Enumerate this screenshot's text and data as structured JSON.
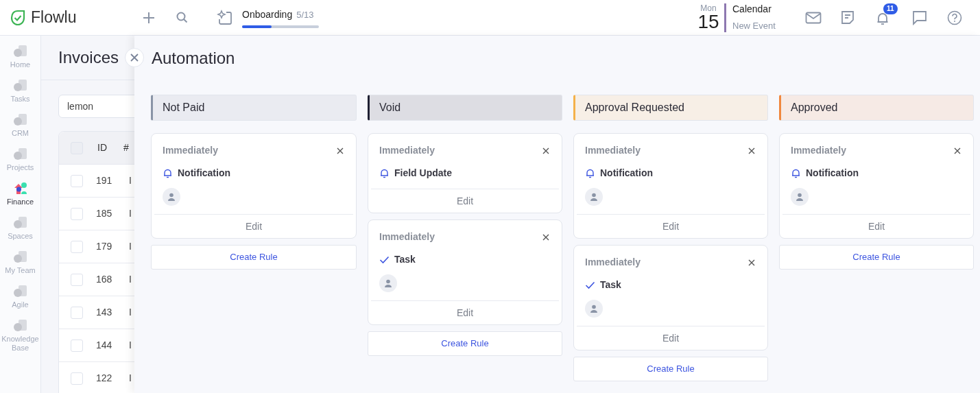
{
  "app": {
    "name": "Flowlu"
  },
  "onboarding": {
    "label": "Onboarding",
    "count": "5/13",
    "level": 0.38
  },
  "calendar": {
    "weekday": "Mon",
    "day": "15",
    "title": "Calendar",
    "subtitle": "New Event"
  },
  "notifications": {
    "badge": "11"
  },
  "sidebar": {
    "items": [
      {
        "label": "Home",
        "selected": false
      },
      {
        "label": "Tasks",
        "selected": false
      },
      {
        "label": "CRM",
        "selected": false
      },
      {
        "label": "Projects",
        "selected": false
      },
      {
        "label": "Finance",
        "selected": true
      },
      {
        "label": "Spaces",
        "selected": false
      },
      {
        "label": "My Team",
        "selected": false
      },
      {
        "label": "Agile",
        "selected": false
      },
      {
        "label": "Knowledge Base",
        "selected": false
      }
    ]
  },
  "invoices": {
    "title": "Invoices",
    "search": {
      "value": "lemon"
    },
    "columns": [
      "ID",
      "#"
    ],
    "select_all": {
      "checked": false
    },
    "rows": [
      {
        "checked": false,
        "id": "191",
        "number": "I"
      },
      {
        "checked": false,
        "id": "185",
        "number": "I"
      },
      {
        "checked": false,
        "id": "179",
        "number": "I"
      },
      {
        "checked": false,
        "id": "168",
        "number": "I"
      },
      {
        "checked": false,
        "id": "143",
        "number": "I"
      },
      {
        "checked": false,
        "id": "144",
        "number": "I"
      },
      {
        "checked": false,
        "id": "122",
        "number": "I"
      }
    ]
  },
  "automation": {
    "title": "Automation",
    "columns": [
      {
        "name": "Not Paid",
        "color": "#8a94a6",
        "rules": [
          {
            "timing": "Immediately",
            "kind": "notification",
            "action": "Notification",
            "avatar": true,
            "edit": "Edit"
          }
        ],
        "create": "Create Rule"
      },
      {
        "name": "Void",
        "color": "#1f2033",
        "rules": [
          {
            "timing": "Immediately",
            "kind": "notification",
            "action": "Field Update",
            "avatar": false,
            "edit": "Edit"
          },
          {
            "timing": "Immediately",
            "kind": "task",
            "action": "Task",
            "avatar": true,
            "edit": "Edit"
          }
        ],
        "create": "Create Rule"
      },
      {
        "name": "Approval Requested",
        "color": "#f4b14a",
        "rules": [
          {
            "timing": "Immediately",
            "kind": "notification",
            "action": "Notification",
            "avatar": true,
            "edit": "Edit"
          },
          {
            "timing": "Immediately",
            "kind": "task",
            "action": "Task",
            "avatar": true,
            "edit": "Edit"
          }
        ],
        "create": "Create Rule"
      },
      {
        "name": "Approved",
        "color": "#f0883e",
        "rules": [
          {
            "timing": "Immediately",
            "kind": "notification",
            "action": "Notification",
            "avatar": true,
            "edit": "Edit"
          }
        ],
        "create": "Create Rule"
      }
    ]
  }
}
